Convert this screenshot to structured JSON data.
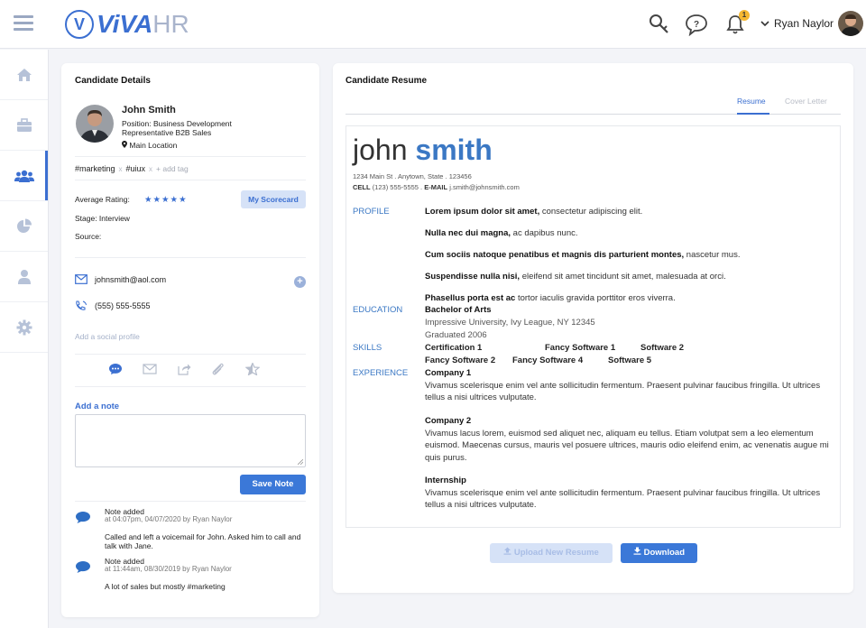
{
  "header": {
    "logo_letter": "V",
    "logo_brand": "ViVA",
    "logo_suffix": "HR",
    "notification_count": "1",
    "user_name": "Ryan Naylor"
  },
  "sidebar": {
    "items": [
      {
        "icon": "home-icon"
      },
      {
        "icon": "briefcase-icon"
      },
      {
        "icon": "users-icon",
        "active": true
      },
      {
        "icon": "pie-chart-icon"
      },
      {
        "icon": "user-icon"
      },
      {
        "icon": "gear-icon"
      }
    ]
  },
  "candidate": {
    "card_title": "Candidate Details",
    "name": "John Smith",
    "position": "Position: Business Development Representative B2B Sales",
    "location": "Main Location",
    "tags": [
      "#marketing",
      "#uiux"
    ],
    "tag_remove": "x",
    "add_tag": "+ add tag",
    "avg_rating_label": "Average Rating:",
    "stars": "★★★★★",
    "scorecard_button": "My Scorecard",
    "stage": "Stage: Interview",
    "source": "Source:",
    "email": "johnsmith@aol.com",
    "phone": "(555) 555-5555",
    "add_social": "Add a social profile",
    "add_note_label": "Add a note",
    "save_note_button": "Save Note",
    "notes": [
      {
        "title": "Note added",
        "meta": "at 04:07pm, 04/07/2020 by Ryan Naylor",
        "body": "Called and left a voicemail for John. Asked him to call and talk with Jane."
      },
      {
        "title": "Note added",
        "meta": "at 11:44am, 08/30/2019 by Ryan Naylor",
        "body": "A lot of sales but mostly #marketing"
      }
    ]
  },
  "resume": {
    "card_title": "Candidate Resume",
    "tabs": [
      "Resume",
      "Cover Letter"
    ],
    "first_name": "john",
    "last_name": "smith",
    "address": "1234 Main St . Anytown, State . 123456",
    "cell_label": "CELL",
    "cell": "(123) 555-5555 .",
    "email_label": "E-MAIL",
    "email": "j.smith@johnsmith.com",
    "sections": {
      "profile": "PROFILE",
      "education": "EDUCATION",
      "skills": "SKILLS",
      "experience": "EXPERIENCE"
    },
    "profile": [
      {
        "bold": "Lorem ipsum dolor sit amet,",
        "rest": " consectetur adipiscing elit."
      },
      {
        "bold": "Nulla nec dui magna,",
        "rest": " ac dapibus nunc."
      },
      {
        "bold": "Cum sociis natoque penatibus et magnis dis parturient montes,",
        "rest": " nascetur mus."
      },
      {
        "bold": "Suspendisse nulla nisi,",
        "rest": " eleifend sit amet tincidunt sit amet, malesuada at orci."
      },
      {
        "bold": "Phasellus porta est ac",
        "rest": " tortor iaculis gravida porttitor eros viverra."
      }
    ],
    "education": {
      "degree": "Bachelor of Arts",
      "school": "Impressive University, Ivy League, NY 12345",
      "graduated": "Graduated 2006"
    },
    "skills_row1": [
      "Certification 1",
      "Fancy Software 1",
      "Software 2"
    ],
    "skills_row2": [
      "Fancy Software 2",
      "Fancy Software 4",
      "Software 5"
    ],
    "experience": [
      {
        "title": "Company 1",
        "text": "Vivamus scelerisque enim vel ante sollicitudin fermentum. Praesent pulvinar faucibus fringilla. Ut ultrices tellus a nisi ultrices vulputate."
      },
      {
        "title": "Company 2",
        "text": "Vivamus lacus lorem, euismod sed aliquet nec, aliquam eu tellus. Etiam volutpat sem a leo elementum euismod. Maecenas cursus, mauris vel posuere ultrices, mauris odio eleifend enim, ac venenatis augue mi quis purus."
      },
      {
        "title": "Internship",
        "text": "Vivamus scelerisque enim vel ante sollicitudin fermentum. Praesent pulvinar faucibus fringilla. Ut ultrices tellus a nisi ultrices vulputate."
      }
    ],
    "upload_button": "Upload New Resume",
    "download_button": "Download"
  },
  "colors": {
    "accent": "#3b6fd1",
    "accent_light": "#d6e2f7",
    "badge": "#f5b731"
  }
}
